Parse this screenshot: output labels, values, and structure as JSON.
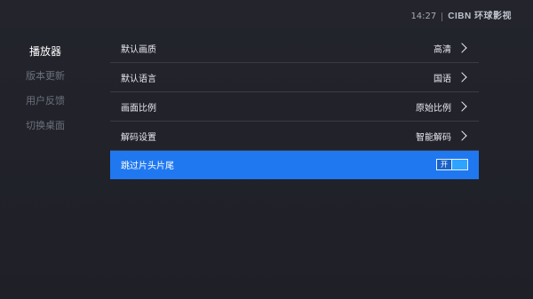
{
  "status_bar": {
    "time": "14:27",
    "brand": "CIBN 环球影视"
  },
  "sidebar": {
    "items": [
      {
        "label": "播放器",
        "active": true
      },
      {
        "label": "版本更新",
        "active": false
      },
      {
        "label": "用户反馈",
        "active": false
      },
      {
        "label": "切换桌面",
        "active": false
      }
    ]
  },
  "settings": {
    "rows": [
      {
        "label": "默认画质",
        "value": "高清"
      },
      {
        "label": "默认语言",
        "value": "国语"
      },
      {
        "label": "画面比例",
        "value": "原始比例"
      },
      {
        "label": "解码设置",
        "value": "智能解码"
      },
      {
        "label": "跳过片头片尾",
        "toggle_text": "开",
        "toggle_on": true
      }
    ]
  },
  "colors": {
    "background": "#22232b",
    "selected_row": "#1f78f0",
    "toggle_knob": "#2fa4ff",
    "inactive_text": "#6d717c"
  }
}
